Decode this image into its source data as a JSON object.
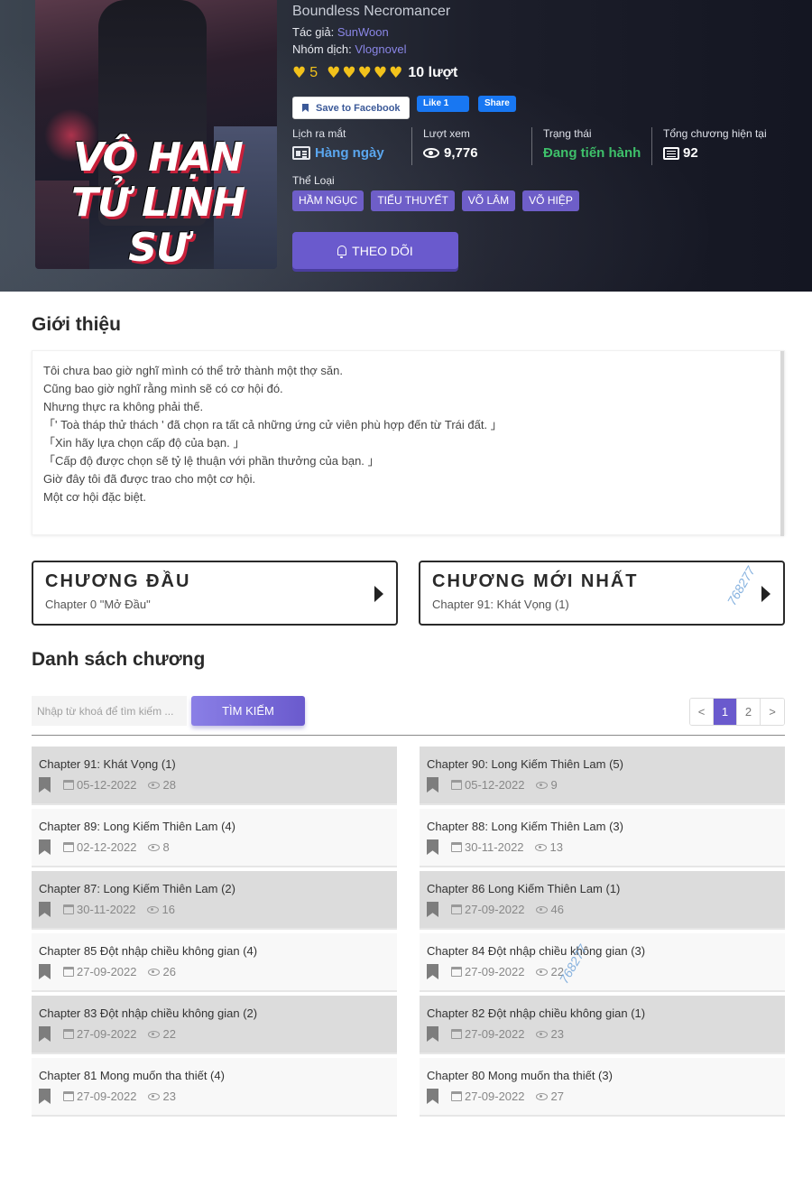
{
  "hero": {
    "cover_title_line1": "VÔ HẠN",
    "cover_title_line2": "TỬ LINH SƯ",
    "alt_name": "Boundless Necromancer",
    "author_label": "Tác giả: ",
    "author": "SunWoon",
    "group_label": "Nhóm dịch: ",
    "group": "Vlognovel",
    "rating_score": "5",
    "rating_stars": 5,
    "rating_count": "10 lượt",
    "social": {
      "save": "Save to Facebook",
      "like": "Like 1",
      "share": "Share"
    },
    "stats": {
      "release_label": "Lịch ra mắt",
      "release_value": "Hàng ngày",
      "views_label": "Lượt xem",
      "views_value": "9,776",
      "status_label": "Trạng thái",
      "status_value": "Đang tiến hành",
      "total_label": "Tổng chương hiện tại",
      "total_value": "92"
    },
    "genre_label": "Thể Loại",
    "genres": [
      "HẦM NGỤC",
      "TIỂU THUYẾT",
      "VÕ LÂM",
      "VÕ HIỆP"
    ],
    "follow": "THEO DÕI"
  },
  "intro": {
    "title": "Giới thiệu",
    "lines": [
      "Tôi chưa bao giờ nghĩ mình có thể trở thành một thợ săn.",
      "Cũng bao giờ nghĩ rằng mình sẽ có cơ hội đó.",
      "Nhưng thực ra không phải thế.",
      "「' Toà tháp thử thách ' đã chọn ra tất cả những ứng cử viên phù hợp đến từ Trái đất. 」",
      "「Xin hãy lựa chọn cấp độ của bạn. 」",
      "「Cấp độ được chọn sẽ tỷ lệ thuận với phần thưởng của bạn. 」",
      "Giờ đây tôi đã được trao cho một cơ hội.",
      "Một cơ hội đặc biệt."
    ]
  },
  "first_chapter": {
    "heading": "CHƯƠNG ĐẦU",
    "name": "Chapter 0 \"Mở Đầu\""
  },
  "latest_chapter": {
    "heading": "CHƯƠNG MỚI NHẤT",
    "name": "Chapter 91: Khát Vọng (1)"
  },
  "watermark": "768277",
  "chapter_list": {
    "title": "Danh sách chương",
    "search_placeholder": "Nhập từ khoá để tìm kiếm ...",
    "search_button": "TÌM KIẾM",
    "pagination": [
      "<",
      "1",
      "2",
      ">"
    ],
    "active_page": "1",
    "chapters": [
      {
        "name": "Chapter 91: Khát Vọng (1)",
        "date": "05-12-2022",
        "views": "28"
      },
      {
        "name": "Chapter 90: Long Kiếm Thiên Lam (5)",
        "date": "05-12-2022",
        "views": "9"
      },
      {
        "name": "Chapter 89: Long Kiếm Thiên Lam (4)",
        "date": "02-12-2022",
        "views": "8"
      },
      {
        "name": "Chapter 88: Long Kiếm Thiên Lam (3)",
        "date": "30-11-2022",
        "views": "13"
      },
      {
        "name": "Chapter 87: Long Kiếm Thiên Lam (2)",
        "date": "30-11-2022",
        "views": "16"
      },
      {
        "name": "Chapter 86 Long Kiếm Thiên Lam (1)",
        "date": "27-09-2022",
        "views": "46"
      },
      {
        "name": "Chapter 85 Đột nhập chiều không gian (4)",
        "date": "27-09-2022",
        "views": "26"
      },
      {
        "name": "Chapter 84 Đột nhập chiều không gian (3)",
        "date": "27-09-2022",
        "views": "22"
      },
      {
        "name": "Chapter 83 Đột nhập chiều không gian (2)",
        "date": "27-09-2022",
        "views": "22"
      },
      {
        "name": "Chapter 82 Đột nhập chiều không gian (1)",
        "date": "27-09-2022",
        "views": "23"
      },
      {
        "name": "Chapter 81 Mong muốn tha thiết (4)",
        "date": "27-09-2022",
        "views": "23"
      },
      {
        "name": "Chapter 80 Mong muốn tha thiết (3)",
        "date": "27-09-2022",
        "views": "27"
      }
    ]
  },
  "colors": {
    "accent": "#6a5acd",
    "heart": "#f2c21b",
    "status_green": "#3ec06a",
    "release_blue": "#5aa6ee"
  }
}
